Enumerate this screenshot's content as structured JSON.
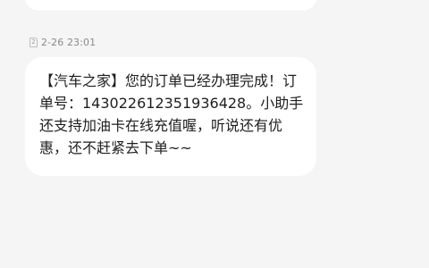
{
  "conversation": {
    "sim_slot": "2",
    "timestamp": "2-26 23:01",
    "message": "【汽车之家】您的订单已经办理完成！订单号：143022612351936428。小助手还支持加油卡在线充值喔，听说还有优惠，还不赶紧去下单~~"
  }
}
